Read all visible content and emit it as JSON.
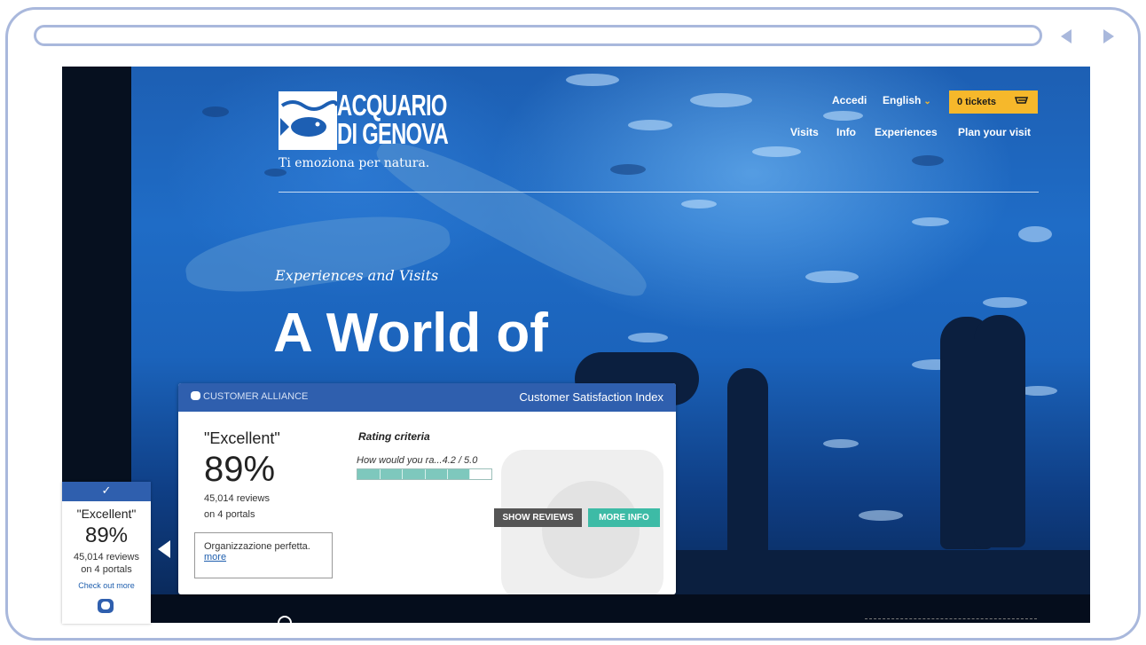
{
  "browser": {
    "back_label": "Back",
    "forward_label": "Forward"
  },
  "header": {
    "logo_line1": "ACQUARIO",
    "logo_line2": "DI GENOVA",
    "tagline": "Ti emoziona per natura.",
    "login_label": "Accedi",
    "language_label": "English",
    "tickets_label": "0 tickets",
    "nav": [
      "Visits",
      "Info",
      "Experiences",
      "Plan your visit"
    ]
  },
  "hero": {
    "kicker": "Experiences and Visits",
    "title": "A World of"
  },
  "customer_alliance": {
    "brand": "CUSTOMER ALLIANCE",
    "index_title": "Customer Satisfaction Index",
    "rating_word": "\"Excellent\"",
    "percentage": "89%",
    "reviews": "45,014 reviews",
    "portals": "on 4 portals",
    "quote": "Organizzazione perfetta.",
    "quote_more": "more",
    "criteria_title": "Rating criteria",
    "criterion_label": "How would you ra...4.2 / 5.0",
    "criterion_score": 4.2,
    "criterion_max": 5.0,
    "show_reviews_label": "SHOW REVIEWS",
    "more_info_label": "MORE INFO"
  },
  "side_widget": {
    "check": "✓",
    "rating_word": "\"Excellent\"",
    "percentage": "89%",
    "reviews": "45,014 reviews",
    "portals": "on 4 portals",
    "check_out": "Check out more"
  },
  "colors": {
    "brand_blue": "#2f5fae",
    "accent_yellow": "#f6b82b",
    "teal": "#3dbba6",
    "frame": "#a9b8dc"
  }
}
